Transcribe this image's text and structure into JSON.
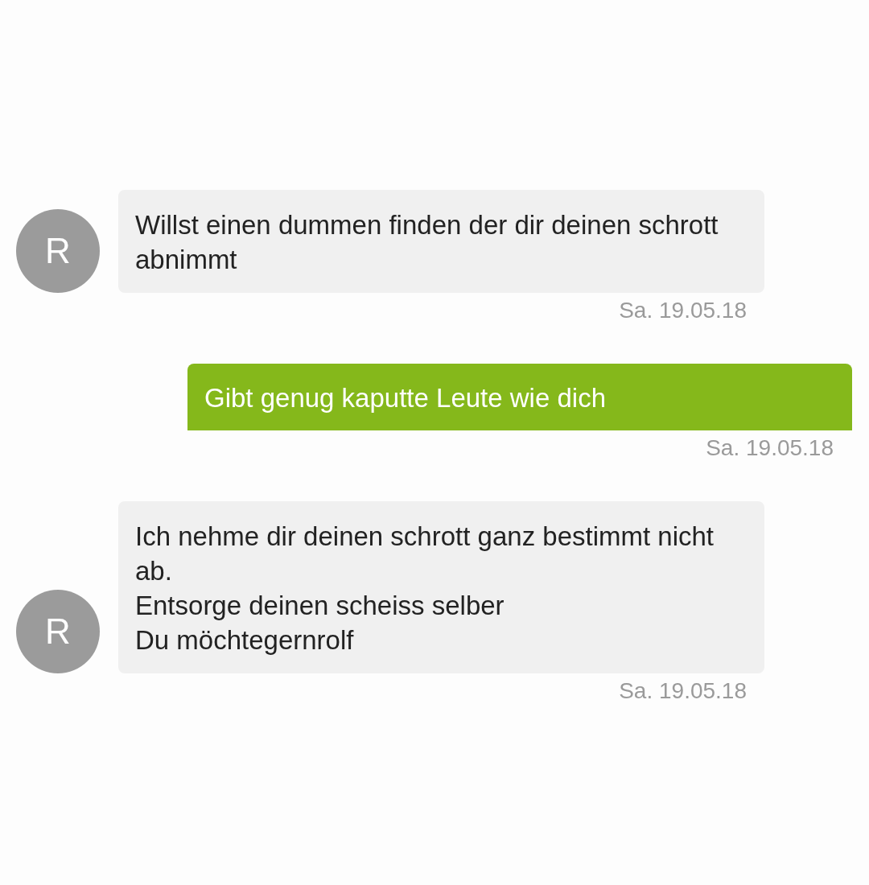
{
  "messages": [
    {
      "kind": "incoming",
      "avatar": "R",
      "text": "Willst einen dummen finden der dir deinen schrott abnimmt",
      "time": "Sa. 19.05.18"
    },
    {
      "kind": "outgoing",
      "text": "Gibt genug kaputte Leute wie dich",
      "time": "Sa. 19.05.18"
    },
    {
      "kind": "incoming",
      "avatar": "R",
      "text": "Ich nehme dir deinen schrott ganz bestimmt nicht ab.\nEntsorge deinen scheiss selber\nDu möchtegernrolf",
      "time": "Sa. 19.05.18"
    }
  ]
}
